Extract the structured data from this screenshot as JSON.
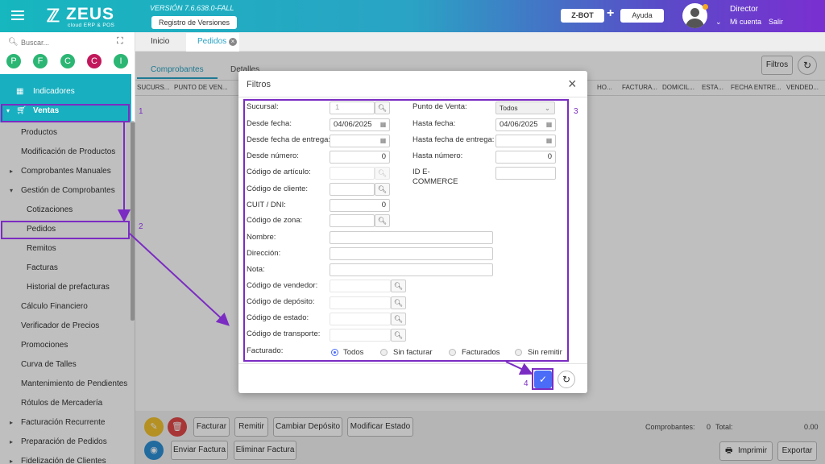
{
  "header": {
    "logo_text": "ZEUS",
    "logo_subtitle": "cloud ERP & POS",
    "version": "VERSIÓN 7.6.638.0-FALL",
    "registro_label": "Registro de Versiones",
    "zbot_label": "Z-BOT",
    "plus": "+",
    "ayuda_label": "Ayuda",
    "user_name": "Director",
    "mi_cuenta": "Mi cuenta",
    "salir": "Salir",
    "colors": {
      "gradient_start": "#16b7bf",
      "gradient_end": "#7a2fd0"
    }
  },
  "sidebar": {
    "search_placeholder": "Buscar...",
    "shortcuts": [
      {
        "letter": "P",
        "color": "#2bb673"
      },
      {
        "letter": "F",
        "color": "#2bb673"
      },
      {
        "letter": "C",
        "color": "#2bb673"
      },
      {
        "letter": "C",
        "color": "#c2185b"
      },
      {
        "letter": "I",
        "color": "#2bb673"
      }
    ],
    "items": [
      {
        "label": "Indicadores",
        "icon": "dashboard-icon"
      },
      {
        "label": "Ventas",
        "icon": "cart-icon"
      },
      {
        "label": "Productos"
      },
      {
        "label": "Modificación de Productos"
      },
      {
        "label": "Comprobantes Manuales"
      },
      {
        "label": "Gestión de Comprobantes"
      },
      {
        "label": "Cotizaciones"
      },
      {
        "label": "Pedidos"
      },
      {
        "label": "Remitos"
      },
      {
        "label": "Facturas"
      },
      {
        "label": "Historial de prefacturas"
      },
      {
        "label": "Cálculo Financiero"
      },
      {
        "label": "Verificador de Precios"
      },
      {
        "label": "Promociones"
      },
      {
        "label": "Curva de Talles"
      },
      {
        "label": "Mantenimiento de Pendientes"
      },
      {
        "label": "Rótulos de Mercadería"
      },
      {
        "label": "Facturación Recurrente"
      },
      {
        "label": "Preparación de Pedidos"
      },
      {
        "label": "Fidelización de Clientes"
      }
    ]
  },
  "tabs": {
    "inicio": "Inicio",
    "pedidos": "Pedidos",
    "close": "×"
  },
  "page_tabs": {
    "comprobantes": "Comprobantes",
    "detalles": "Detalles"
  },
  "toolbar": {
    "filtros": "Filtros",
    "refresh": "↻"
  },
  "table_headers": [
    "SUCURS...",
    "PUNTO DE VEN...",
    "HO...",
    "FACTURA...",
    "DOMICIL...",
    "ESTA...",
    "FECHA ENTRE...",
    "VENDED..."
  ],
  "modal": {
    "title": "Filtros",
    "close": "×",
    "labels": {
      "sucursal": "Sucursal:",
      "punto_venta": "Punto de Venta:",
      "desde_fecha": "Desde fecha:",
      "hasta_fecha": "Hasta fecha:",
      "desde_fecha_entrega": "Desde fecha de entrega:",
      "hasta_fecha_entrega": "Hasta fecha de entrega:",
      "desde_numero": "Desde número:",
      "hasta_numero": "Hasta número:",
      "codigo_articulo": "Código de artículo:",
      "id_ecommerce_1": "ID E-",
      "id_ecommerce_2": "COMMERCE",
      "codigo_cliente": "Código de cliente:",
      "cuit": "CUIT / DNI:",
      "codigo_zona": "Código de zona:",
      "nombre": "Nombre:",
      "direccion": "Dirección:",
      "nota": "Nota:",
      "codigo_vendedor": "Código de vendedor:",
      "codigo_deposito": "Código de depósito:",
      "codigo_estado": "Código de estado:",
      "codigo_transporte": "Código de transporte:",
      "facturado": "Facturado:"
    },
    "values": {
      "sucursal": "1",
      "punto_venta": "Todos",
      "desde_fecha": "04/06/2025",
      "hasta_fecha": "04/06/2025",
      "desde_numero": "0",
      "hasta_numero": "0",
      "cuit": "0"
    },
    "radios": [
      {
        "label": "Todos",
        "selected": true
      },
      {
        "label": "Sin facturar",
        "selected": false
      },
      {
        "label": "Facturados",
        "selected": false
      },
      {
        "label": "Sin remitir",
        "selected": false
      }
    ],
    "ok": "✓",
    "reset": "↻"
  },
  "bottom": {
    "facturar": "Facturar",
    "remitir": "Remitir",
    "cambiar_deposito": "Cambiar Depósito",
    "modificar_estado": "Modificar Estado",
    "enviar_factura": "Enviar Factura",
    "eliminar_factura": "Eliminar Factura",
    "comprobantes_label": "Comprobantes:",
    "comprobantes_count": "0",
    "total_label": "Total:",
    "total_value": "0.00",
    "imprimir": "Imprimir",
    "exportar": "Exportar"
  },
  "annotations": [
    "1",
    "2",
    "3",
    "4"
  ]
}
